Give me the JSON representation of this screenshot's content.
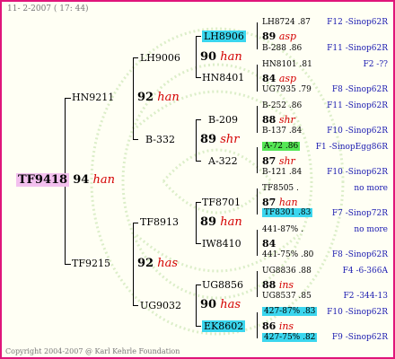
{
  "header": {
    "date": "11-  2-2007 ( 17: 44)"
  },
  "footer": {
    "copyright": "Copyright 2004-2007 @ Karl Kehrle Foundation"
  },
  "subject": {
    "name": "TF9418",
    "year": "94",
    "race": "han"
  },
  "gen1": {
    "top": {
      "name": "HN9211",
      "year": "92",
      "race": "han"
    },
    "bottom": {
      "name": "TF9215",
      "year": "92",
      "race": "has"
    }
  },
  "gen2": [
    {
      "name": "LH9006",
      "year": "90",
      "race": "han"
    },
    {
      "name": "B-332",
      "year": "89",
      "race": "shr"
    },
    {
      "name": "TF8913",
      "year": "89",
      "race": "han"
    },
    {
      "name": "UG9032",
      "year": "90",
      "race": "has"
    }
  ],
  "gen3": [
    {
      "name": "LH8906",
      "year": "89",
      "race": "asp"
    },
    {
      "name": "HN8401",
      "year": "84",
      "race": "asp"
    },
    {
      "name": "B-209",
      "year": "88",
      "race": "shr"
    },
    {
      "name": "A-322",
      "year": "87",
      "race": "shr"
    },
    {
      "name": "TF8701",
      "year": "87",
      "race": "han"
    },
    {
      "name": "IW8410",
      "year": "84",
      "race": ""
    },
    {
      "name": "UG8856",
      "year": "88",
      "race": "ins"
    },
    {
      "name": "EK8602",
      "year": "86",
      "race": "ins"
    }
  ],
  "gen4": [
    {
      "name": "LH8724 .87",
      "year": "89",
      "race": "asp",
      "name2": "B-288 .86",
      "right1": "F12 -Sinop62R",
      "right2": "F11 -Sinop62R"
    },
    {
      "name": "HN8101 .81",
      "year": "84",
      "race": "asp",
      "name2": "UG7935 .79",
      "right1": "F2 -??",
      "right2": "F8 -Sinop62R"
    },
    {
      "name": "B-252 .86",
      "year": "88",
      "race": "shr",
      "name2": "B-137 .84",
      "right1": "F11 -Sinop62R",
      "right2": "F10 -Sinop62R"
    },
    {
      "name": "A-72 .86",
      "year": "87",
      "race": "shr",
      "name2": "B-121 .84",
      "right1": "F1 -SinopEgg86R",
      "right2": "F10 -Sinop62R"
    },
    {
      "name": "TF8505 .",
      "year": "87",
      "race": "han",
      "name2": "TF8301 .83",
      "right1": "no more",
      "right2": "F7 -Sinop72R"
    },
    {
      "name": "441-87% .",
      "year": "84",
      "race": "",
      "name2": "441-75% .80",
      "right1": "no more",
      "right2": "F8 -Sinop62R"
    },
    {
      "name": "UG8836 .88",
      "year": "88",
      "race": "ins",
      "name2": "UG8537 .85",
      "right1": "F4 -6-366A",
      "right2": "F2 -344-13"
    },
    {
      "name": "427-87% .83",
      "year": "86",
      "race": "ins",
      "name2": "427-75% .82",
      "right1": "F10 -Sinop62R",
      "right2": "F9 -Sinop62R"
    }
  ]
}
